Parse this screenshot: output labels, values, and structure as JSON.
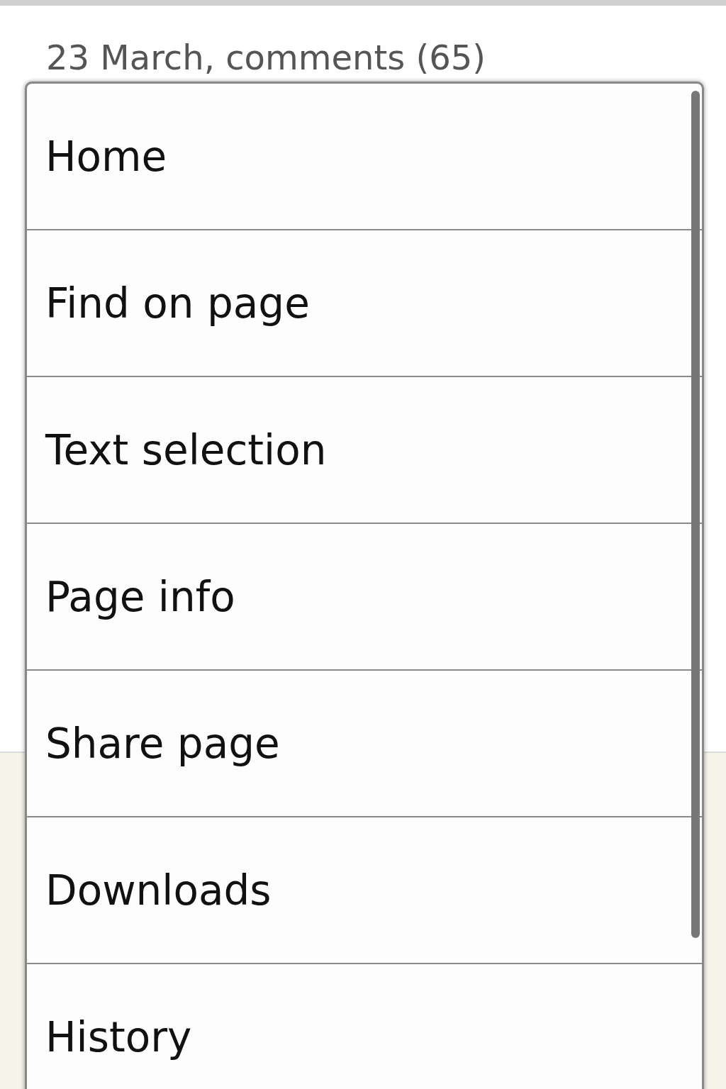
{
  "article": {
    "meta": "23 March, comments (65)"
  },
  "menu": {
    "items": [
      {
        "label": "Home"
      },
      {
        "label": "Find on page"
      },
      {
        "label": "Text selection"
      },
      {
        "label": "Page info"
      },
      {
        "label": "Share page"
      },
      {
        "label": "Downloads"
      },
      {
        "label": "History"
      }
    ]
  }
}
